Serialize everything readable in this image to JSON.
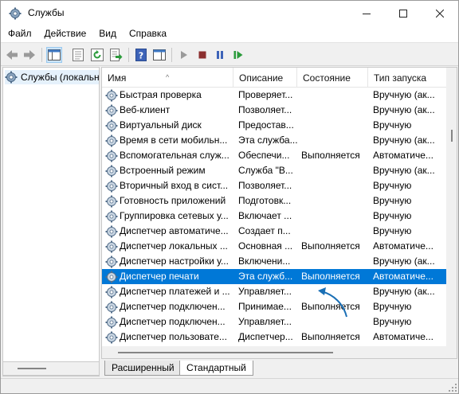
{
  "window": {
    "title": "Службы",
    "minimize_icon": "minimize-icon",
    "maximize_icon": "maximize-icon",
    "close_icon": "close-icon"
  },
  "menu": [
    "Файл",
    "Действие",
    "Вид",
    "Справка"
  ],
  "toolbar": {
    "icons": [
      "back-arrow-icon",
      "forward-arrow-icon",
      "show-tree-icon",
      "properties-icon",
      "refresh-icon",
      "export-list-icon",
      "help-icon",
      "show-hide-pane-icon",
      "start-service-icon",
      "stop-service-icon",
      "pause-service-icon",
      "restart-service-icon"
    ]
  },
  "tree": {
    "root_label": "Службы (локальные)"
  },
  "list": {
    "columns": [
      "Имя",
      "Описание",
      "Состояние",
      "Тип запуска"
    ],
    "sort_indicator": "^",
    "rows": [
      {
        "name": "Быстрая проверка",
        "desc": "Проверяет...",
        "state": "",
        "start": "Вручную (ак..."
      },
      {
        "name": "Веб-клиент",
        "desc": "Позволяет...",
        "state": "",
        "start": "Вручную (ак..."
      },
      {
        "name": "Виртуальный диск",
        "desc": "Предостав...",
        "state": "",
        "start": "Вручную"
      },
      {
        "name": "Время в сети мобильн...",
        "desc": "Эта служба...",
        "state": "",
        "start": "Вручную (ак..."
      },
      {
        "name": "Вспомогательная служ...",
        "desc": "Обеспечи...",
        "state": "Выполняется",
        "start": "Автоматиче..."
      },
      {
        "name": "Встроенный режим",
        "desc": "Служба \"В...",
        "state": "",
        "start": "Вручную (ак..."
      },
      {
        "name": "Вторичный вход в сист...",
        "desc": "Позволяет...",
        "state": "",
        "start": "Вручную"
      },
      {
        "name": "Готовность приложений",
        "desc": "Подготовк...",
        "state": "",
        "start": "Вручную"
      },
      {
        "name": "Группировка сетевых у...",
        "desc": "Включает ...",
        "state": "",
        "start": "Вручную"
      },
      {
        "name": "Диспетчер автоматиче...",
        "desc": "Создает п...",
        "state": "",
        "start": "Вручную"
      },
      {
        "name": "Диспетчер локальных ...",
        "desc": "Основная ...",
        "state": "Выполняется",
        "start": "Автоматиче..."
      },
      {
        "name": "Диспетчер настройки у...",
        "desc": "Включени...",
        "state": "",
        "start": "Вручную (ак..."
      },
      {
        "name": "Диспетчер печати",
        "desc": "Эта служб...",
        "state": "Выполняется",
        "start": "Автоматиче..."
      },
      {
        "name": "Диспетчер платежей и ...",
        "desc": "Управляет...",
        "state": "",
        "start": "Вручную (ак..."
      },
      {
        "name": "Диспетчер подключен...",
        "desc": "Принимае...",
        "state": "Выполняется",
        "start": "Вручную"
      },
      {
        "name": "Диспетчер подключен...",
        "desc": "Управляет...",
        "state": "",
        "start": "Вручную"
      },
      {
        "name": "Диспетчер пользовате...",
        "desc": "Диспетчер...",
        "state": "Выполняется",
        "start": "Автоматиче..."
      }
    ],
    "selected_row": "Диспетчер печати"
  },
  "tabs": [
    "Расширенный",
    "Стандартный"
  ],
  "active_tab": "Стандартный",
  "colors": {
    "selection": "#0078d7",
    "annotation_arrow": "#1a6fb5"
  }
}
